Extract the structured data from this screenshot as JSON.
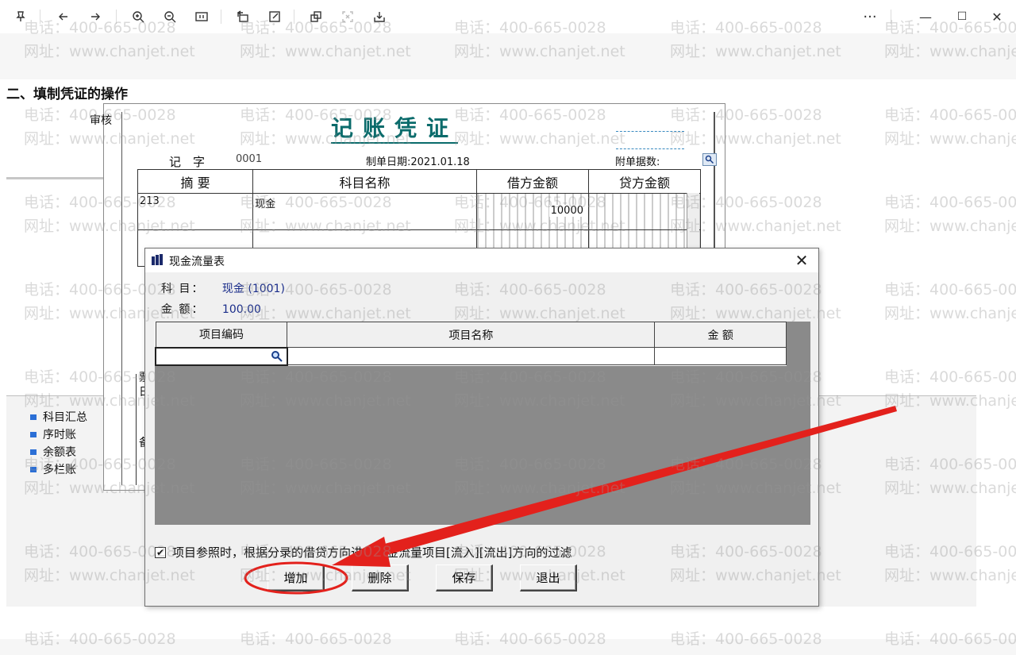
{
  "toolbar": {
    "buttons": [
      "pin-icon",
      "back-icon",
      "forward-icon",
      "zoom-in-icon",
      "zoom-out-icon",
      "fit-icon",
      "rotate-icon",
      "edit-icon",
      "crop-icon",
      "screenshot-icon",
      "save-icon"
    ],
    "more_label": "···"
  },
  "window_controls": {
    "minimize": "—",
    "maximize": "☐",
    "close": "✕"
  },
  "watermark": {
    "phone": "电话：400-665-0028",
    "site": "网址：www.chanjet.net"
  },
  "heading": "二、填制凭证的操作",
  "left_nav": {
    "items": [
      "科目汇总",
      "序时账",
      "余额表",
      "多栏账"
    ]
  },
  "voucher": {
    "partial_label": "审核",
    "title": "记账凭证",
    "type_label": "记　字",
    "number": "0001",
    "date_label": "制单日期:2021.01.18",
    "attach_label": "附单据数:",
    "headers": [
      "摘 要",
      "科目名称",
      "借方金额",
      "贷方金额"
    ],
    "rows": [
      {
        "summary": "213",
        "account": "现金",
        "debit": "10000",
        "credit": ""
      }
    ],
    "side_labels": [
      "票",
      "日",
      "备"
    ]
  },
  "dialog": {
    "title": "现金流量表",
    "subject_label": "科 目：",
    "subject_value": "现金 (1001)",
    "amount_label": "金 额：",
    "amount_value": "100.00",
    "grid_headers": [
      "项目编码",
      "项目名称",
      "金 额"
    ],
    "code_value": "",
    "filter_label": "项目参照时，根据分录的借贷方向进行现金流量项目[流入][流出]方向的过滤",
    "filter_checked": "✔",
    "buttons": {
      "add": "增加",
      "delete": "删除",
      "save": "保存",
      "exit": "退出"
    },
    "close_glyph": "✕"
  },
  "colors": {
    "annotation_red": "#e3211c",
    "voucher_title": "#0a6b6b",
    "value_blue": "#1a2d8a"
  }
}
